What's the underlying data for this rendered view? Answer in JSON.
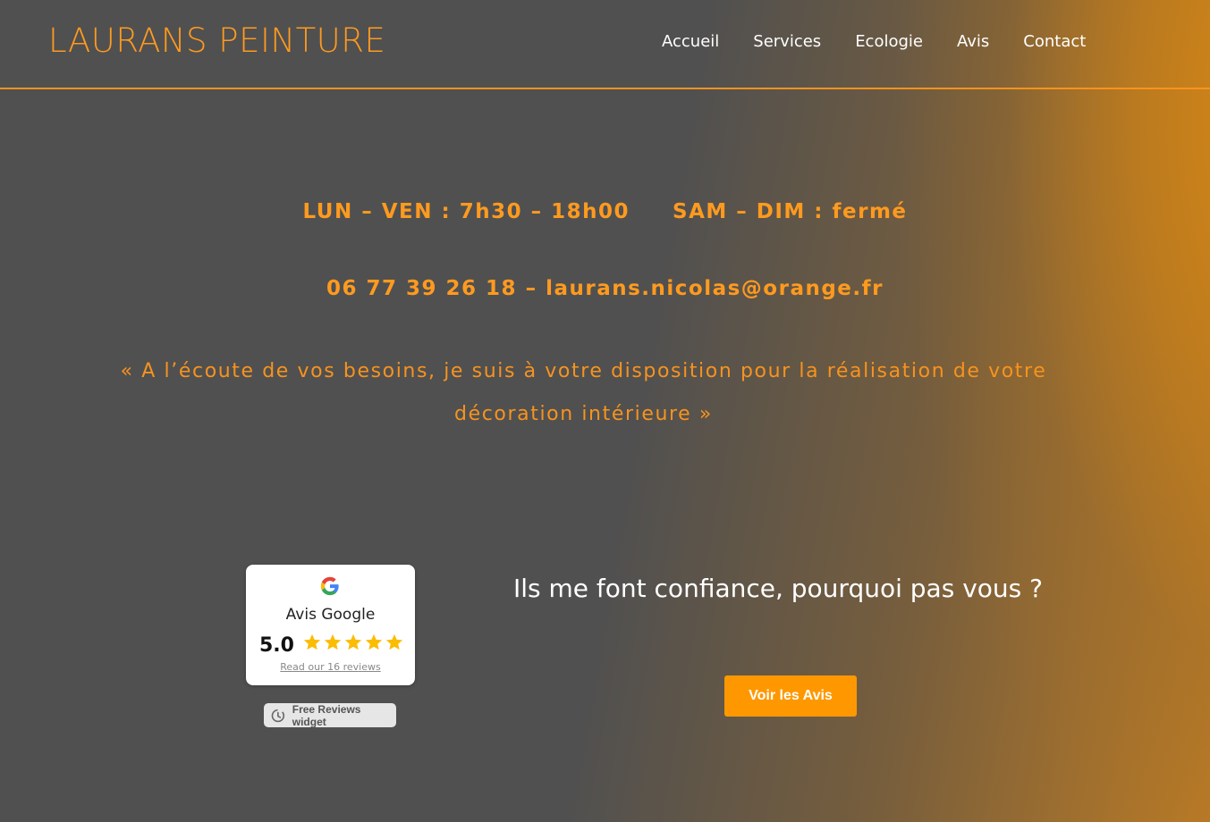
{
  "header": {
    "logo": "LAURANS PEINTURE",
    "nav": [
      "Accueil",
      "Services",
      "Ecologie",
      "Avis",
      "Contact"
    ]
  },
  "info": {
    "hours_week": "LUN – VEN : 7h30 – 18h00",
    "hours_weekend": "SAM – DIM : fermé",
    "contact": "06 77 39 26 18 – laurans.nicolas@orange.fr",
    "quote": "« A l’écoute de vos besoins, je suis à votre disposition pour la réalisation de votre décoration intérieure »"
  },
  "reviews": {
    "icon": "google-g-icon",
    "title": "Avis Google",
    "score": "5.0",
    "rating": 5,
    "rating_max": 5,
    "link": "Read our 16 reviews",
    "badge": "Free Reviews widget"
  },
  "cta_section": {
    "tagline": "Ils me font confiance, pourquoi pas vous ?",
    "button": "Voir les Avis"
  },
  "colors": {
    "accent": "#ff9a1f",
    "background": "#505050",
    "button": "#ff9800",
    "star": "#fbbc04"
  }
}
